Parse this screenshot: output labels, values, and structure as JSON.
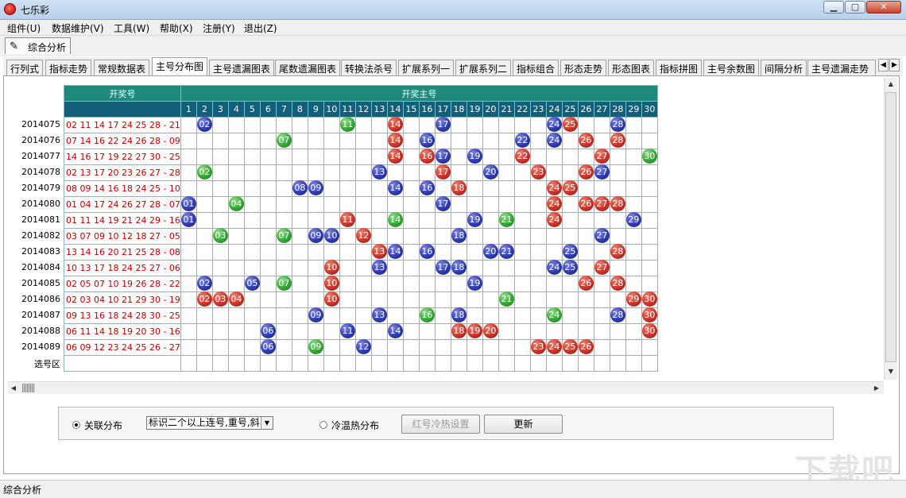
{
  "window": {
    "title": "七乐彩",
    "min": "▁",
    "max": "▢",
    "close": "✕"
  },
  "menu": [
    "组件(U)",
    "数据维护(V)",
    "工具(W)",
    "帮助(X)",
    "注册(Y)",
    "退出(Z)"
  ],
  "doc_tab": "综合分析",
  "tabs": [
    "行列式",
    "指标走势",
    "常规数据表",
    "主号分布图",
    "主号遗漏图表",
    "尾数遗漏图表",
    "转换法杀号",
    "扩展系列一",
    "扩展系列二",
    "指标组合",
    "形态走势",
    "形态图表",
    "指标拼图",
    "主号余数图",
    "间隔分析",
    "主号遗漏走势"
  ],
  "active_tab": 3,
  "grid": {
    "header_left": "开奖号",
    "header_right": "开奖主号",
    "numbers": [
      "1",
      "2",
      "3",
      "4",
      "5",
      "6",
      "7",
      "8",
      "9",
      "10",
      "11",
      "12",
      "13",
      "14",
      "15",
      "16",
      "17",
      "18",
      "19",
      "20",
      "21",
      "22",
      "23",
      "24",
      "25",
      "26",
      "27",
      "28",
      "29",
      "30"
    ],
    "rows": [
      {
        "issue": "2014075",
        "draw": "02 11 14 17 24 25 28 - 21",
        "balls": [
          [
            2,
            "blue"
          ],
          [
            11,
            "green"
          ],
          [
            14,
            "red"
          ],
          [
            17,
            "blue"
          ],
          [
            24,
            "blue"
          ],
          [
            25,
            "red"
          ],
          [
            28,
            "blue"
          ]
        ]
      },
      {
        "issue": "2014076",
        "draw": "07 14 16 22 24 26 28 - 09",
        "balls": [
          [
            7,
            "green"
          ],
          [
            14,
            "red"
          ],
          [
            16,
            "blue"
          ],
          [
            22,
            "blue"
          ],
          [
            24,
            "blue"
          ],
          [
            26,
            "red"
          ],
          [
            28,
            "red"
          ]
        ]
      },
      {
        "issue": "2014077",
        "draw": "14 16 17 19 22 27 30 - 25",
        "balls": [
          [
            14,
            "red"
          ],
          [
            16,
            "red"
          ],
          [
            17,
            "blue"
          ],
          [
            19,
            "blue"
          ],
          [
            22,
            "red"
          ],
          [
            27,
            "red"
          ],
          [
            30,
            "green"
          ]
        ]
      },
      {
        "issue": "2014078",
        "draw": "02 13 17 20 23 26 27 - 28",
        "balls": [
          [
            2,
            "green"
          ],
          [
            13,
            "blue"
          ],
          [
            17,
            "red"
          ],
          [
            20,
            "blue"
          ],
          [
            23,
            "red"
          ],
          [
            26,
            "red"
          ],
          [
            27,
            "blue"
          ]
        ]
      },
      {
        "issue": "2014079",
        "draw": "08 09 14 16 18 24 25 - 10",
        "balls": [
          [
            8,
            "blue"
          ],
          [
            9,
            "blue"
          ],
          [
            14,
            "blue"
          ],
          [
            16,
            "blue"
          ],
          [
            18,
            "red"
          ],
          [
            24,
            "red"
          ],
          [
            25,
            "red"
          ]
        ]
      },
      {
        "issue": "2014080",
        "draw": "01 04 17 24 26 27 28 - 07",
        "balls": [
          [
            1,
            "blue"
          ],
          [
            4,
            "green"
          ],
          [
            17,
            "blue"
          ],
          [
            24,
            "red"
          ],
          [
            26,
            "red"
          ],
          [
            27,
            "red"
          ],
          [
            28,
            "red"
          ]
        ]
      },
      {
        "issue": "2014081",
        "draw": "01 11 14 19 21 24 29 - 16",
        "balls": [
          [
            1,
            "blue"
          ],
          [
            11,
            "red"
          ],
          [
            14,
            "green"
          ],
          [
            19,
            "blue"
          ],
          [
            21,
            "green"
          ],
          [
            24,
            "red"
          ],
          [
            29,
            "blue"
          ]
        ]
      },
      {
        "issue": "2014082",
        "draw": "03 07 09 10 12 18 27 - 05",
        "balls": [
          [
            3,
            "green"
          ],
          [
            7,
            "green"
          ],
          [
            9,
            "blue"
          ],
          [
            10,
            "blue"
          ],
          [
            12,
            "red"
          ],
          [
            18,
            "blue"
          ],
          [
            27,
            "blue"
          ]
        ]
      },
      {
        "issue": "2014083",
        "draw": "13 14 16 20 21 25 28 - 08",
        "balls": [
          [
            13,
            "red"
          ],
          [
            14,
            "blue"
          ],
          [
            16,
            "blue"
          ],
          [
            20,
            "blue"
          ],
          [
            21,
            "blue"
          ],
          [
            25,
            "blue"
          ],
          [
            28,
            "red"
          ]
        ]
      },
      {
        "issue": "2014084",
        "draw": "10 13 17 18 24 25 27 - 06",
        "balls": [
          [
            10,
            "red"
          ],
          [
            13,
            "blue"
          ],
          [
            17,
            "blue"
          ],
          [
            18,
            "blue"
          ],
          [
            24,
            "blue"
          ],
          [
            25,
            "blue"
          ],
          [
            27,
            "red"
          ]
        ]
      },
      {
        "issue": "2014085",
        "draw": "02 05 07 10 19 26 28 - 22",
        "balls": [
          [
            2,
            "blue"
          ],
          [
            5,
            "blue"
          ],
          [
            7,
            "green"
          ],
          [
            10,
            "red"
          ],
          [
            19,
            "blue"
          ],
          [
            26,
            "red"
          ],
          [
            28,
            "red"
          ]
        ]
      },
      {
        "issue": "2014086",
        "draw": "02 03 04 10 21 29 30 - 19",
        "balls": [
          [
            2,
            "red"
          ],
          [
            3,
            "red"
          ],
          [
            4,
            "red"
          ],
          [
            10,
            "red"
          ],
          [
            21,
            "green"
          ],
          [
            29,
            "red"
          ],
          [
            30,
            "red"
          ]
        ]
      },
      {
        "issue": "2014087",
        "draw": "09 13 16 18 24 28 30 - 25",
        "balls": [
          [
            9,
            "blue"
          ],
          [
            13,
            "blue"
          ],
          [
            16,
            "green"
          ],
          [
            18,
            "blue"
          ],
          [
            24,
            "green"
          ],
          [
            28,
            "blue"
          ],
          [
            30,
            "red"
          ]
        ]
      },
      {
        "issue": "2014088",
        "draw": "06 11 14 18 19 20 30 - 16",
        "balls": [
          [
            6,
            "blue"
          ],
          [
            11,
            "blue"
          ],
          [
            14,
            "blue"
          ],
          [
            18,
            "red"
          ],
          [
            19,
            "red"
          ],
          [
            20,
            "red"
          ],
          [
            30,
            "red"
          ]
        ]
      },
      {
        "issue": "2014089",
        "draw": "06 09 12 23 24 25 26 - 27",
        "balls": [
          [
            6,
            "blue"
          ],
          [
            9,
            "green"
          ],
          [
            12,
            "blue"
          ],
          [
            23,
            "red"
          ],
          [
            24,
            "red"
          ],
          [
            25,
            "red"
          ],
          [
            26,
            "red"
          ]
        ]
      }
    ],
    "select_row_label": "选号区"
  },
  "controls": {
    "radio1": "关联分布",
    "select_value": "标识二个以上连号,重号,斜",
    "radio2": "冷温热分布",
    "hot_cold_btn": "红号冷热设置",
    "refresh_btn": "更新"
  },
  "status": "综合分析",
  "watermark": "下载吧",
  "colors": {
    "red_ball": "#c8342a",
    "blue_ball": "#2f3cae",
    "green_ball": "#33a633",
    "header_green": "#1d8a7b",
    "header_blue": "#115f79",
    "draw_text": "#c00000"
  }
}
